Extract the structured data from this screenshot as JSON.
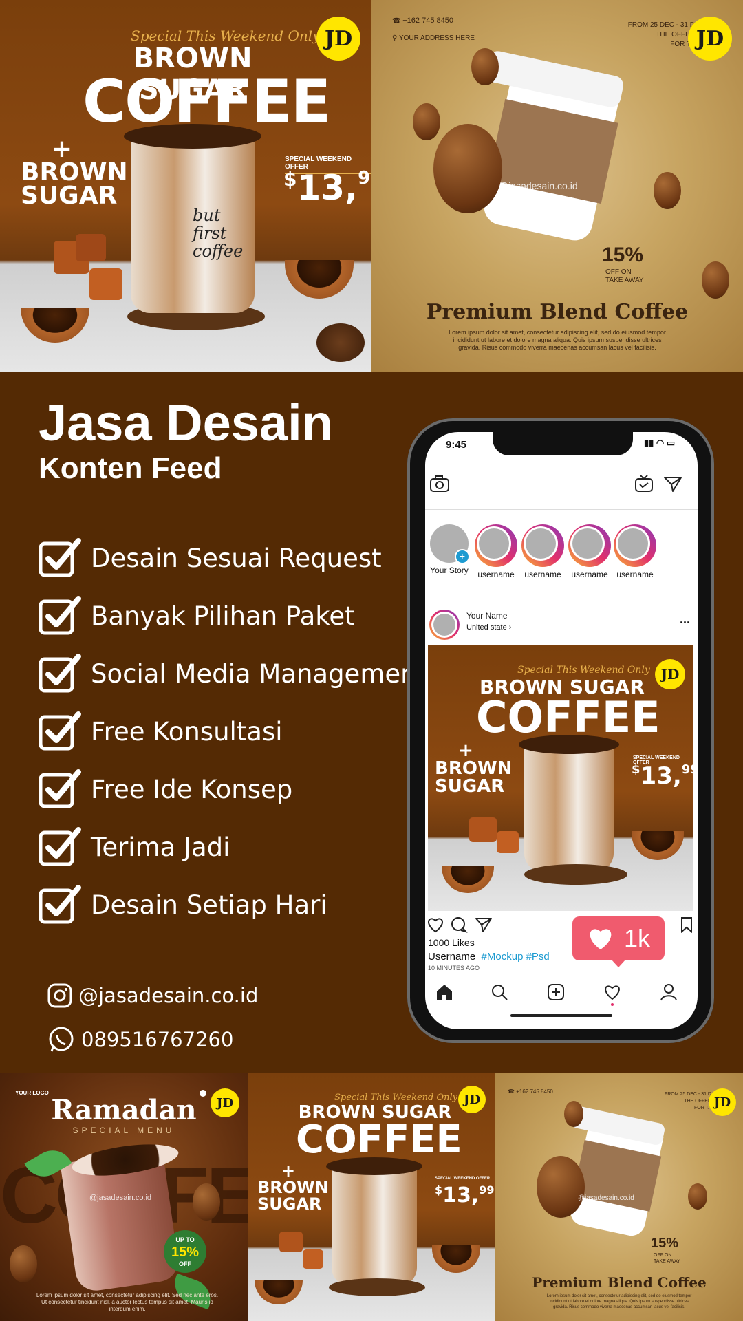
{
  "brand": {
    "logo_text": "JD",
    "handle": "@jasadesain.co.id"
  },
  "promo_brown_sugar": {
    "script_line": "Special This Weekend Only",
    "line1": "BROWN SUGAR",
    "line2": "COFFEE",
    "side_plus": "+",
    "side_line1": "BROWN",
    "side_line2": "SUGAR",
    "offer_label": "SPECIAL WEEKEND OFFER",
    "price_currency": "$",
    "price_main": "13,",
    "price_cents": "99",
    "cup_text": "but first coffee"
  },
  "promo_premium": {
    "phone": "+162 745 8450",
    "address": "YOUR ADDRESS HERE",
    "date_line": "FROM 25 DEC - 31 D",
    "date_line2": "THE OFFER",
    "date_line3": "FOR TA",
    "discount": "15%",
    "discount_sub1": "OFF ON",
    "discount_sub2": "TAKE AWAY",
    "headline": "Premium Blend Coffee",
    "body": "Lorem ipsum dolor sit amet, consectetur adipiscing elit, sed do eiusmod tempor incididunt ut labore et dolore magna aliqua. Quis ipsum suspendisse ultrices gravida. Risus commodo viverra maecenas accumsan lacus vel facilisis."
  },
  "promo_ramadan": {
    "logo_small": "YOUR LOGO",
    "title": "Ramadan",
    "subtitle": "SPECIAL MENU",
    "bg_word": "COFFEE",
    "badge_top": "UP TO",
    "badge_value": "15%",
    "badge_bottom": "OFF",
    "body": "Lorem ipsum dolor sit amet, consectetur adipiscing elit. Sed nec ante eros. Ut consectetur tincidunt nisl, a auctor lectus tempus sit amet. Mauris id interdum enim."
  },
  "main": {
    "title": "Jasa Desain",
    "subtitle": "Konten Feed",
    "features": [
      "Desain Sesuai Request",
      "Banyak Pilihan Paket",
      "Social Media Management",
      "Free Konsultasi",
      "Free Ide Konsep",
      "Terima Jadi",
      "Desain Setiap Hari"
    ],
    "instagram": "@jasadesain.co.id",
    "whatsapp": "089516767260"
  },
  "phone": {
    "time": "9:45",
    "stories": [
      "Your Story",
      "username",
      "username",
      "username",
      "username"
    ],
    "post_name": "Your Name",
    "post_location": "United state",
    "likes": "1000 Likes",
    "caption_user": "Username",
    "caption_tags": "#Mockup #Psd",
    "time_ago": "10 MINUTES AGO",
    "notif_count": "1k",
    "more": "..."
  },
  "colors": {
    "background": "#542a04",
    "logo_yellow": "#ffe600",
    "notif_red": "#f05b6e",
    "hashtag_blue": "#1d9bd1"
  }
}
